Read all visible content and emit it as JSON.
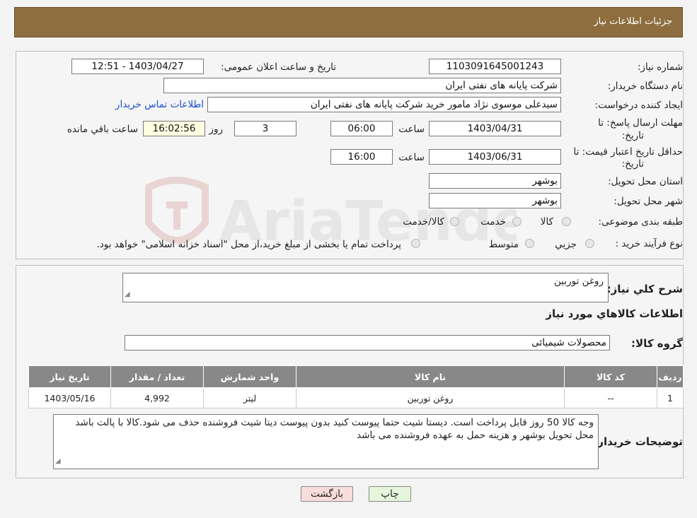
{
  "header": {
    "title": "جزئیات اطلاعات نیاز"
  },
  "form": {
    "need_number_label": "شماره نیاز:",
    "need_number": "1103091645001243",
    "announce_label": "تاریخ و ساعت اعلان عمومی:",
    "announce_value": "1403/04/27 - 12:51",
    "buyer_org_label": "نام دستگاه خریدار:",
    "buyer_org": "شرکت پایانه های نفتی ایران",
    "creator_label": "ایجاد کننده درخواست:",
    "creator": "سیدعلی موسوی نژاد مامور خرید شرکت پایانه های نفتی ایران",
    "contact_link": "اطلاعات تماس خریدار",
    "deadline_label_1": "مهلت ارسال پاسخ: تا",
    "deadline_label_2": "تاریخ:",
    "deadline_date": "1403/04/31",
    "time_label": "ساعت",
    "deadline_time": "06:00",
    "days_value": "3",
    "days_label": "روز و",
    "remaining_time": "16:02:56",
    "remaining_label": "ساعت باقي مانده",
    "validity_label_1": "حداقل تاریخ اعتبار قیمت: تا",
    "validity_label_2": "تاریخ:",
    "validity_date": "1403/06/31",
    "validity_time": "16:00",
    "province_label": "استان محل تحویل:",
    "province": "بوشهر",
    "city_label": "شهر محل تحویل:",
    "city": "بوشهر",
    "category_label": "طبقه بندی موضوعی:",
    "category_options": [
      "کالا",
      "خدمت",
      "کالا/خدمت"
    ],
    "process_label": "نوع فرآیند خرید :",
    "process_options": [
      "جزیي",
      "متوسط"
    ],
    "process_note": "پرداخت تمام یا بخشی از مبلغ خرید،از محل \"اسناد خزانه اسلامی\" خواهد بود."
  },
  "details": {
    "summary_label": "شرح کلي نیاز:",
    "summary": "روغن توربین",
    "goods_info_title": "اطلاعات کالاهاي مورد نیاز",
    "group_label": "گروه کالا:",
    "group_value": "محصولات شیمیائی",
    "table": {
      "headers": [
        "ردیف",
        "کد کالا",
        "نام کالا",
        "واحد شمارش",
        "تعداد / مقدار",
        "تاریخ نیاز"
      ],
      "rows": [
        [
          "1",
          "--",
          "روغن توربین",
          "لیتر",
          "4,992",
          "1403/05/16"
        ]
      ]
    },
    "notes_label": "توضیحات خریدار:",
    "notes": "وجه کالا 50 روز قابل پرداخت است. دیستا شیت حتما پیوست کنید بدون پیوست دیتا شیت فروشنده حذف می شود.کالا با پالت باشد محل تحویل بوشهر و هزینه حمل به عهده فروشنده می باشد"
  },
  "buttons": {
    "print": "چاپ",
    "back": "بازگشت"
  },
  "watermark": {
    "text": "AriaTender.neT"
  },
  "colors": {
    "header_bg": "#8e6e3e",
    "link": "#1a4fcf",
    "table_header": "#888888",
    "back_btn": "#f9dcdc",
    "print_btn": "#e5f6dc"
  }
}
